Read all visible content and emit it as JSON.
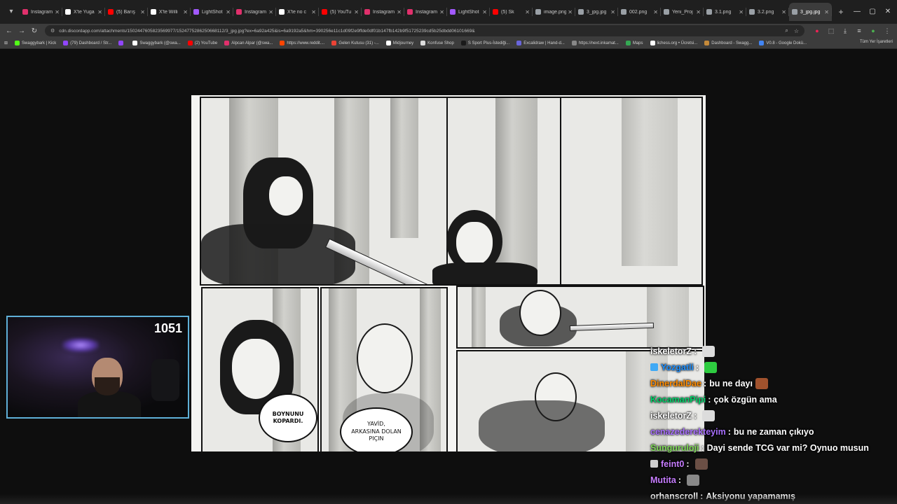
{
  "browser": {
    "tabs": [
      {
        "label": "Instagram",
        "color": "#e1306c",
        "icon": "instagram-icon"
      },
      {
        "label": "X'te Yuga",
        "color": "#ffffff",
        "icon": "x-icon"
      },
      {
        "label": "(5) Barış",
        "color": "#ff0000",
        "icon": "youtube-icon"
      },
      {
        "label": "X'te Willi",
        "color": "#ffffff",
        "icon": "x-icon"
      },
      {
        "label": "LightShot",
        "color": "#a259ff",
        "icon": "lightshot-icon"
      },
      {
        "label": "Instagram",
        "color": "#e1306c",
        "icon": "instagram-icon"
      },
      {
        "label": "X'te no c",
        "color": "#ffffff",
        "icon": "x-icon"
      },
      {
        "label": "(5) YouTu",
        "color": "#ff0000",
        "icon": "youtube-icon"
      },
      {
        "label": "Instagram",
        "color": "#e1306c",
        "icon": "instagram-icon"
      },
      {
        "label": "Instagram",
        "color": "#e1306c",
        "icon": "instagram-icon"
      },
      {
        "label": "LightShot",
        "color": "#a259ff",
        "icon": "lightshot-icon"
      },
      {
        "label": "(5) Sk",
        "color": "#ff0000",
        "icon": "youtube-icon"
      },
      {
        "label": "image.png",
        "color": "#9aa0a6",
        "icon": "globe-icon"
      },
      {
        "label": "3_jpg.jpg",
        "color": "#9aa0a6",
        "icon": "globe-icon"
      },
      {
        "label": "002.png",
        "color": "#9aa0a6",
        "icon": "globe-icon"
      },
      {
        "label": "Yeni_Proj",
        "color": "#9aa0a6",
        "icon": "globe-icon"
      },
      {
        "label": "3.1.png",
        "color": "#9aa0a6",
        "icon": "globe-icon"
      },
      {
        "label": "3.2.png",
        "color": "#9aa0a6",
        "icon": "globe-icon"
      },
      {
        "label": "3_jpg.jpg",
        "color": "#9aa0a6",
        "icon": "globe-icon",
        "active": true
      }
    ],
    "url": "cdn.discordapp.com/attachments/1502447605823569977/1524775286250668112/3_jpg.jpg?ex=6a92a425&is=6a9192a5&hm=390256e11c1d09f2e9ffde0df01b147fb142b9f51725239cd5b25dbdd06101669&",
    "bookmarks": [
      {
        "label": "Swaggybark | Kick",
        "color": "#53fc18"
      },
      {
        "label": "(79) Dashboard / Str...",
        "color": "#9146ff"
      },
      {
        "label": "",
        "color": "#9146ff"
      },
      {
        "label": "Swaggybark (@swa...",
        "color": "#ffffff"
      },
      {
        "label": "(2) YouTube",
        "color": "#ff0000"
      },
      {
        "label": "Alpcan Alpar (@swa...",
        "color": "#e1306c"
      },
      {
        "label": "https://www.reddit....",
        "color": "#ff4500"
      },
      {
        "label": "Gelen Kutusu (31) -...",
        "color": "#ea4335"
      },
      {
        "label": "Midjourney",
        "color": "#ffffff"
      },
      {
        "label": "Konfuse Shop",
        "color": "#dddddd"
      },
      {
        "label": "S Sport Plus-İstediği...",
        "color": "#1a1a1a"
      },
      {
        "label": "Excalidraw | Hand-d...",
        "color": "#6965db"
      },
      {
        "label": "https://next.inkamat...",
        "color": "#888888"
      },
      {
        "label": "Maps",
        "color": "#34a853"
      },
      {
        "label": "lichess.org • Ücretsi...",
        "color": "#ffffff"
      },
      {
        "label": "Dashboard - Swagg...",
        "color": "#c58a3a"
      },
      {
        "label": "V0.8 - Google Dokü...",
        "color": "#4285f4"
      }
    ],
    "bookmarks_all": "Tüm Yer İşaretleri"
  },
  "comic": {
    "bubble1": "BOYNUNU\nKOPARDI.",
    "bubble2": "YAVİD,\nARKASINA DOLAN\nPIÇIN"
  },
  "webcam": {
    "viewer_count": "1051",
    "border_color": "#5fb0d8"
  },
  "chat": [
    {
      "user": "iskeletorZ",
      "user_color": "#ffffff",
      "message": "",
      "emote": "skull-emote",
      "emote_color": "#dcdcdc"
    },
    {
      "user": "Yozgatli",
      "user_color": "#1e90ff",
      "message": "",
      "emote": "gauge-emote",
      "emote_color": "#2ecc40",
      "badge_color": "#3fa9f5"
    },
    {
      "user": "DinerdalDae",
      "user_color": "#ff8c00",
      "message": "bu ne dayı",
      "emote": "face-emote",
      "emote_color": "#a0522d"
    },
    {
      "user": "KocamanPipi",
      "user_color": "#00d26a",
      "message": "çok özgün ama",
      "emote": "",
      "emote_color": ""
    },
    {
      "user": "iskeletorZ",
      "user_color": "#ffffff",
      "message": "",
      "emote": "skull-emote",
      "emote_color": "#dcdcdc"
    },
    {
      "user": "cenazederekteyim",
      "user_color": "#a970ff",
      "message": "bu ne zaman çıkıyo",
      "emote": "",
      "emote_color": ""
    },
    {
      "user": "Sunguruloji",
      "user_color": "#7ed957",
      "message": "Dayi sende TCG var mi? Oynuo musun",
      "emote": "",
      "emote_color": ""
    },
    {
      "user": "feint0",
      "user_color": "#c77dff",
      "message": "",
      "emote": "face-emote",
      "emote_color": "#6b4f45",
      "badge_color": "#cfcfcf"
    },
    {
      "user": "Mutita",
      "user_color": "#c77dff",
      "message": "",
      "emote": "stone-emote",
      "emote_color": "#888888"
    },
    {
      "user": "orhanscroll",
      "user_color": "#ffffff",
      "message": "Aksiyonu yapamamış",
      "emote": "",
      "emote_color": ""
    }
  ]
}
